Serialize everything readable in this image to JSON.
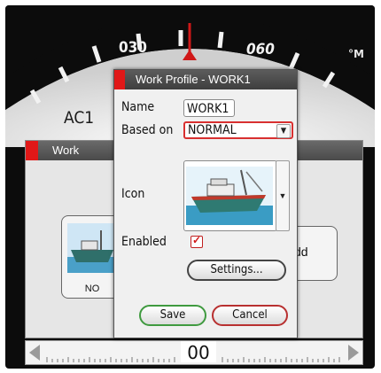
{
  "compass": {
    "labels": [
      "030",
      "060"
    ],
    "unit": "°M",
    "autopilot_label": "AC1"
  },
  "work_panel": {
    "title": "Work",
    "profile_caption": "NO",
    "add_label": "dd"
  },
  "dialog": {
    "title": "Work Profile - WORK1",
    "name_label": "Name",
    "name_value": "WORK1",
    "based_on_label": "Based on",
    "based_on_value": "NORMAL",
    "icon_label": "Icon",
    "enabled_label": "Enabled",
    "enabled": true,
    "settings_button": "Settings...",
    "save_button": "Save",
    "cancel_button": "Cancel"
  },
  "rudder": {
    "value": "00"
  },
  "colors": {
    "accent_red": "#e01818",
    "save_green": "#3f9a3f",
    "cancel_red": "#b83030"
  }
}
